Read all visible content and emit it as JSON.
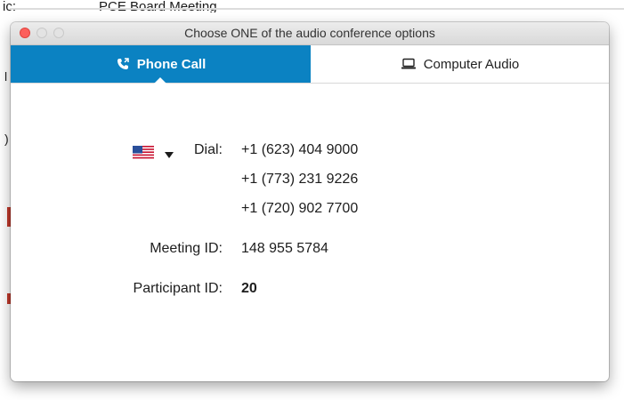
{
  "background": {
    "topic_key": "ic:",
    "topic_value": "PCE Board Meeting"
  },
  "dialog": {
    "title": "Choose ONE of the audio conference options",
    "tabs": [
      {
        "label": "Phone Call",
        "icon": "phone-icon",
        "active": true
      },
      {
        "label": "Computer Audio",
        "icon": "laptop-icon",
        "active": false
      }
    ],
    "country": {
      "flag": "us-flag-icon"
    },
    "dial_label": "Dial:",
    "dial_numbers": [
      "+1 (623) 404 9000",
      "+1 (773) 231 9226",
      "+1 (720) 902 7700"
    ],
    "meeting_id_label": "Meeting ID:",
    "meeting_id": "148 955 5784",
    "participant_id_label": "Participant ID:",
    "participant_id": "20"
  },
  "colors": {
    "active_tab": "#0b82c2",
    "close_light": "#fc605c"
  }
}
